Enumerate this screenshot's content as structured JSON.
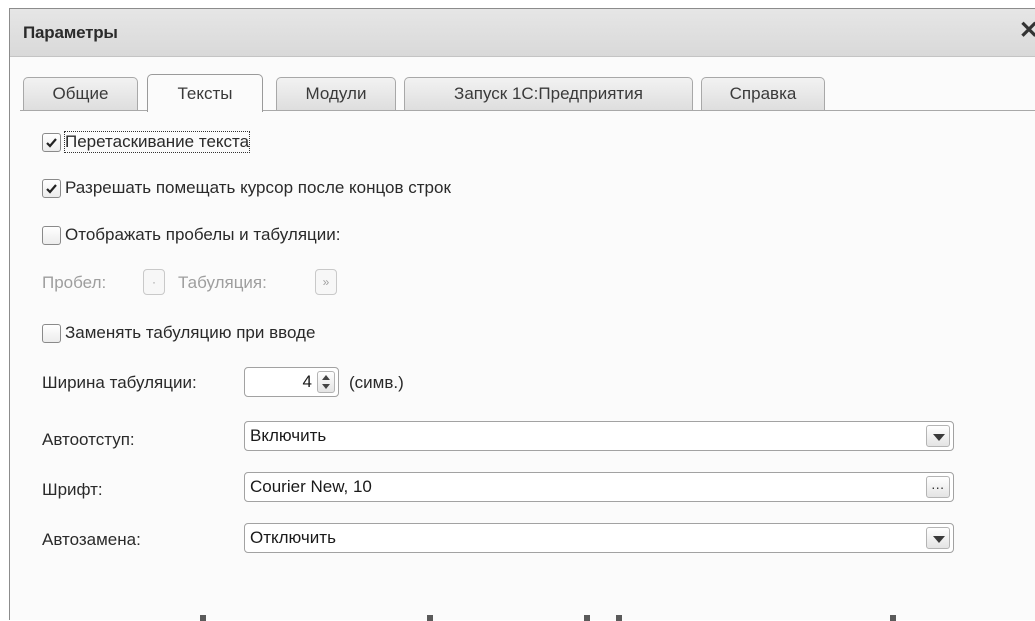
{
  "window": {
    "title": "Параметры",
    "close_glyph": "✕"
  },
  "tabs": [
    {
      "label": "Общие",
      "active": false
    },
    {
      "label": "Тексты",
      "active": true
    },
    {
      "label": "Модули",
      "active": false
    },
    {
      "label": "Запуск 1С:Предприятия",
      "active": false
    },
    {
      "label": "Справка",
      "active": false
    }
  ],
  "options": {
    "drag_text": {
      "label": "Перетаскивание текста",
      "checked": true
    },
    "cursor_after_eol": {
      "label": "Разрешать помещать курсор после концов строк",
      "checked": true
    },
    "show_whitespace": {
      "label": "Отображать пробелы и табуляции:",
      "checked": false
    },
    "space_label": "Пробел:",
    "space_glyph": "·",
    "tab_label": "Табуляция:",
    "tab_glyph": "»",
    "replace_tab": {
      "label": "Заменять табуляцию при вводе",
      "checked": false
    },
    "tab_width_label": "Ширина табуляции:",
    "tab_width_value": "4",
    "tab_width_unit": "(симв.)",
    "autoindent_label": "Автоотступ:",
    "autoindent_value": "Включить",
    "font_label": "Шрифт:",
    "font_value": "Courier New, 10",
    "font_button": "...",
    "autoreplace_label": "Автозамена:",
    "autoreplace_value": "Отключить"
  }
}
